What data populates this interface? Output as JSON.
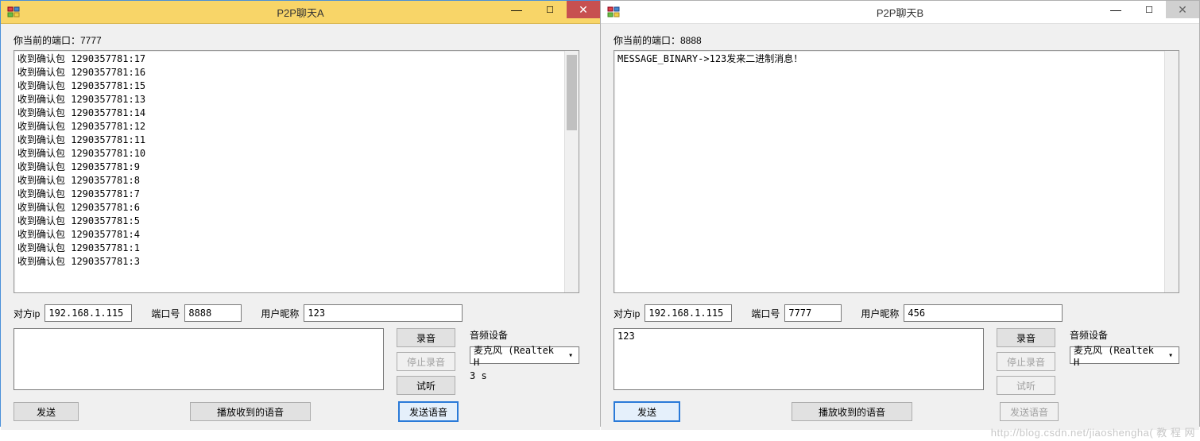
{
  "windows": [
    {
      "title": "P2P聊天A",
      "port_label": "你当前的端口：7777",
      "log_lines": [
        "收到确认包 1290357781:17",
        "收到确认包 1290357781:16",
        "收到确认包 1290357781:15",
        "收到确认包 1290357781:13",
        "收到确认包 1290357781:14",
        "收到确认包 1290357781:12",
        "收到确认包 1290357781:11",
        "收到确认包 1290357781:10",
        "收到确认包 1290357781:9",
        "收到确认包 1290357781:8",
        "收到确认包 1290357781:7",
        "收到确认包 1290357781:6",
        "收到确认包 1290357781:5",
        "收到确认包 1290357781:4",
        "收到确认包 1290357781:1",
        "收到确认包 1290357781:3"
      ],
      "peer_ip_label": "对方ip",
      "peer_ip": "192.168.1.115",
      "port_field_label": "端口号",
      "port_field": "8888",
      "nick_label": "用户昵称",
      "nick": "123",
      "msg": "",
      "audio_label": "音频设备",
      "audio_device": "麦克风 (Realtek H",
      "record": "录音",
      "stop_record": "停止录音",
      "preview": "试听",
      "send": "发送",
      "play_received": "播放收到的语音",
      "send_voice": "发送语音",
      "duration": "3 s",
      "record_enabled": true,
      "stop_enabled": false,
      "preview_enabled": true,
      "send_voice_enabled": true,
      "send_voice_primary": true,
      "close_style": "close-a"
    },
    {
      "title": "P2P聊天B",
      "port_label": "你当前的端口：8888",
      "log_lines": [
        "MESSAGE_BINARY->123发来二进制消息！"
      ],
      "peer_ip_label": "对方ip",
      "peer_ip": "192.168.1.115",
      "port_field_label": "端口号",
      "port_field": "7777",
      "nick_label": "用户昵称",
      "nick": "456",
      "msg": "123",
      "audio_label": "音频设备",
      "audio_device": "麦克风 (Realtek H",
      "record": "录音",
      "stop_record": "停止录音",
      "preview": "试听",
      "send": "发送",
      "play_received": "播放收到的语音",
      "send_voice": "发送语音",
      "duration": "",
      "record_enabled": true,
      "stop_enabled": false,
      "preview_enabled": false,
      "send_voice_enabled": false,
      "send_voice_primary": false,
      "send_primary": true,
      "close_style": "close-b"
    }
  ],
  "watermark": "http://blog.csdn.net/jiaoshengha( 教 程 网"
}
